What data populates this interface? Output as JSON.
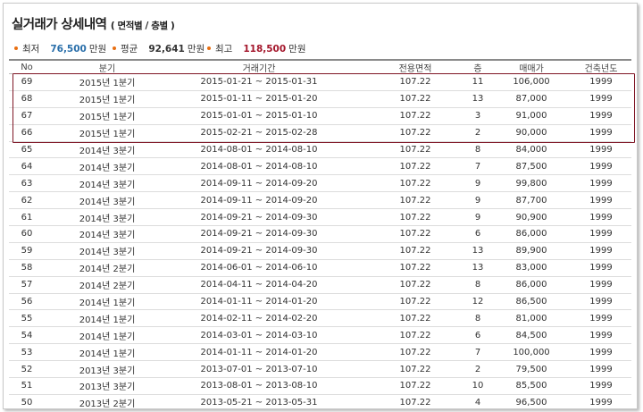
{
  "title": {
    "main": "실거래가 상세내역",
    "sub": "( 면적별 / 층별 )"
  },
  "stats": {
    "min": {
      "label": "최저",
      "value": "76,500",
      "unit": "만원"
    },
    "avg": {
      "label": "평균",
      "value": "92,641",
      "unit": "만원"
    },
    "max": {
      "label": "최고",
      "value": "118,500",
      "unit": "만원"
    }
  },
  "colors": {
    "accent_dot": "#e86f12",
    "min_value": "#2a6faa",
    "max_value": "#a4162b",
    "highlight_border": "#7f1625"
  },
  "table": {
    "headers": [
      "No",
      "분기",
      "거래기간",
      "전용면적",
      "층",
      "매매가",
      "건축년도"
    ],
    "rows": [
      [
        "69",
        "2015년 1분기",
        "2015-01-21 ~ 2015-01-31",
        "107.22",
        "11",
        "106,000",
        "1999"
      ],
      [
        "68",
        "2015년 1분기",
        "2015-01-11 ~ 2015-01-20",
        "107.22",
        "13",
        "87,000",
        "1999"
      ],
      [
        "67",
        "2015년 1분기",
        "2015-01-01 ~ 2015-01-10",
        "107.22",
        "3",
        "91,000",
        "1999"
      ],
      [
        "66",
        "2015년 1분기",
        "2015-02-21 ~ 2015-02-28",
        "107.22",
        "2",
        "90,000",
        "1999"
      ],
      [
        "65",
        "2014년 3분기",
        "2014-08-01 ~ 2014-08-10",
        "107.22",
        "8",
        "84,000",
        "1999"
      ],
      [
        "64",
        "2014년 3분기",
        "2014-08-01 ~ 2014-08-10",
        "107.22",
        "7",
        "87,500",
        "1999"
      ],
      [
        "63",
        "2014년 3분기",
        "2014-09-11 ~ 2014-09-20",
        "107.22",
        "9",
        "99,800",
        "1999"
      ],
      [
        "62",
        "2014년 3분기",
        "2014-09-11 ~ 2014-09-20",
        "107.22",
        "9",
        "87,700",
        "1999"
      ],
      [
        "61",
        "2014년 3분기",
        "2014-09-21 ~ 2014-09-30",
        "107.22",
        "9",
        "90,900",
        "1999"
      ],
      [
        "60",
        "2014년 3분기",
        "2014-09-21 ~ 2014-09-30",
        "107.22",
        "6",
        "86,000",
        "1999"
      ],
      [
        "59",
        "2014년 3분기",
        "2014-09-21 ~ 2014-09-30",
        "107.22",
        "13",
        "89,900",
        "1999"
      ],
      [
        "58",
        "2014년 2분기",
        "2014-06-01 ~ 2014-06-10",
        "107.22",
        "13",
        "83,000",
        "1999"
      ],
      [
        "57",
        "2014년 2분기",
        "2014-04-11 ~ 2014-04-20",
        "107.22",
        "8",
        "86,000",
        "1999"
      ],
      [
        "56",
        "2014년 1분기",
        "2014-01-11 ~ 2014-01-20",
        "107.22",
        "12",
        "86,500",
        "1999"
      ],
      [
        "55",
        "2014년 1분기",
        "2014-02-11 ~ 2014-02-20",
        "107.22",
        "8",
        "81,000",
        "1999"
      ],
      [
        "54",
        "2014년 1분기",
        "2014-03-01 ~ 2014-03-10",
        "107.22",
        "6",
        "84,500",
        "1999"
      ],
      [
        "53",
        "2014년 1분기",
        "2014-01-11 ~ 2014-01-20",
        "107.22",
        "7",
        "100,000",
        "1999"
      ],
      [
        "52",
        "2013년 3분기",
        "2013-07-01 ~ 2013-07-10",
        "107.22",
        "2",
        "79,500",
        "1999"
      ],
      [
        "51",
        "2013년 3분기",
        "2013-08-01 ~ 2013-08-10",
        "107.22",
        "10",
        "85,500",
        "1999"
      ],
      [
        "50",
        "2013년 2분기",
        "2013-05-21 ~ 2013-05-31",
        "107.22",
        "4",
        "96,500",
        "1999"
      ]
    ]
  }
}
